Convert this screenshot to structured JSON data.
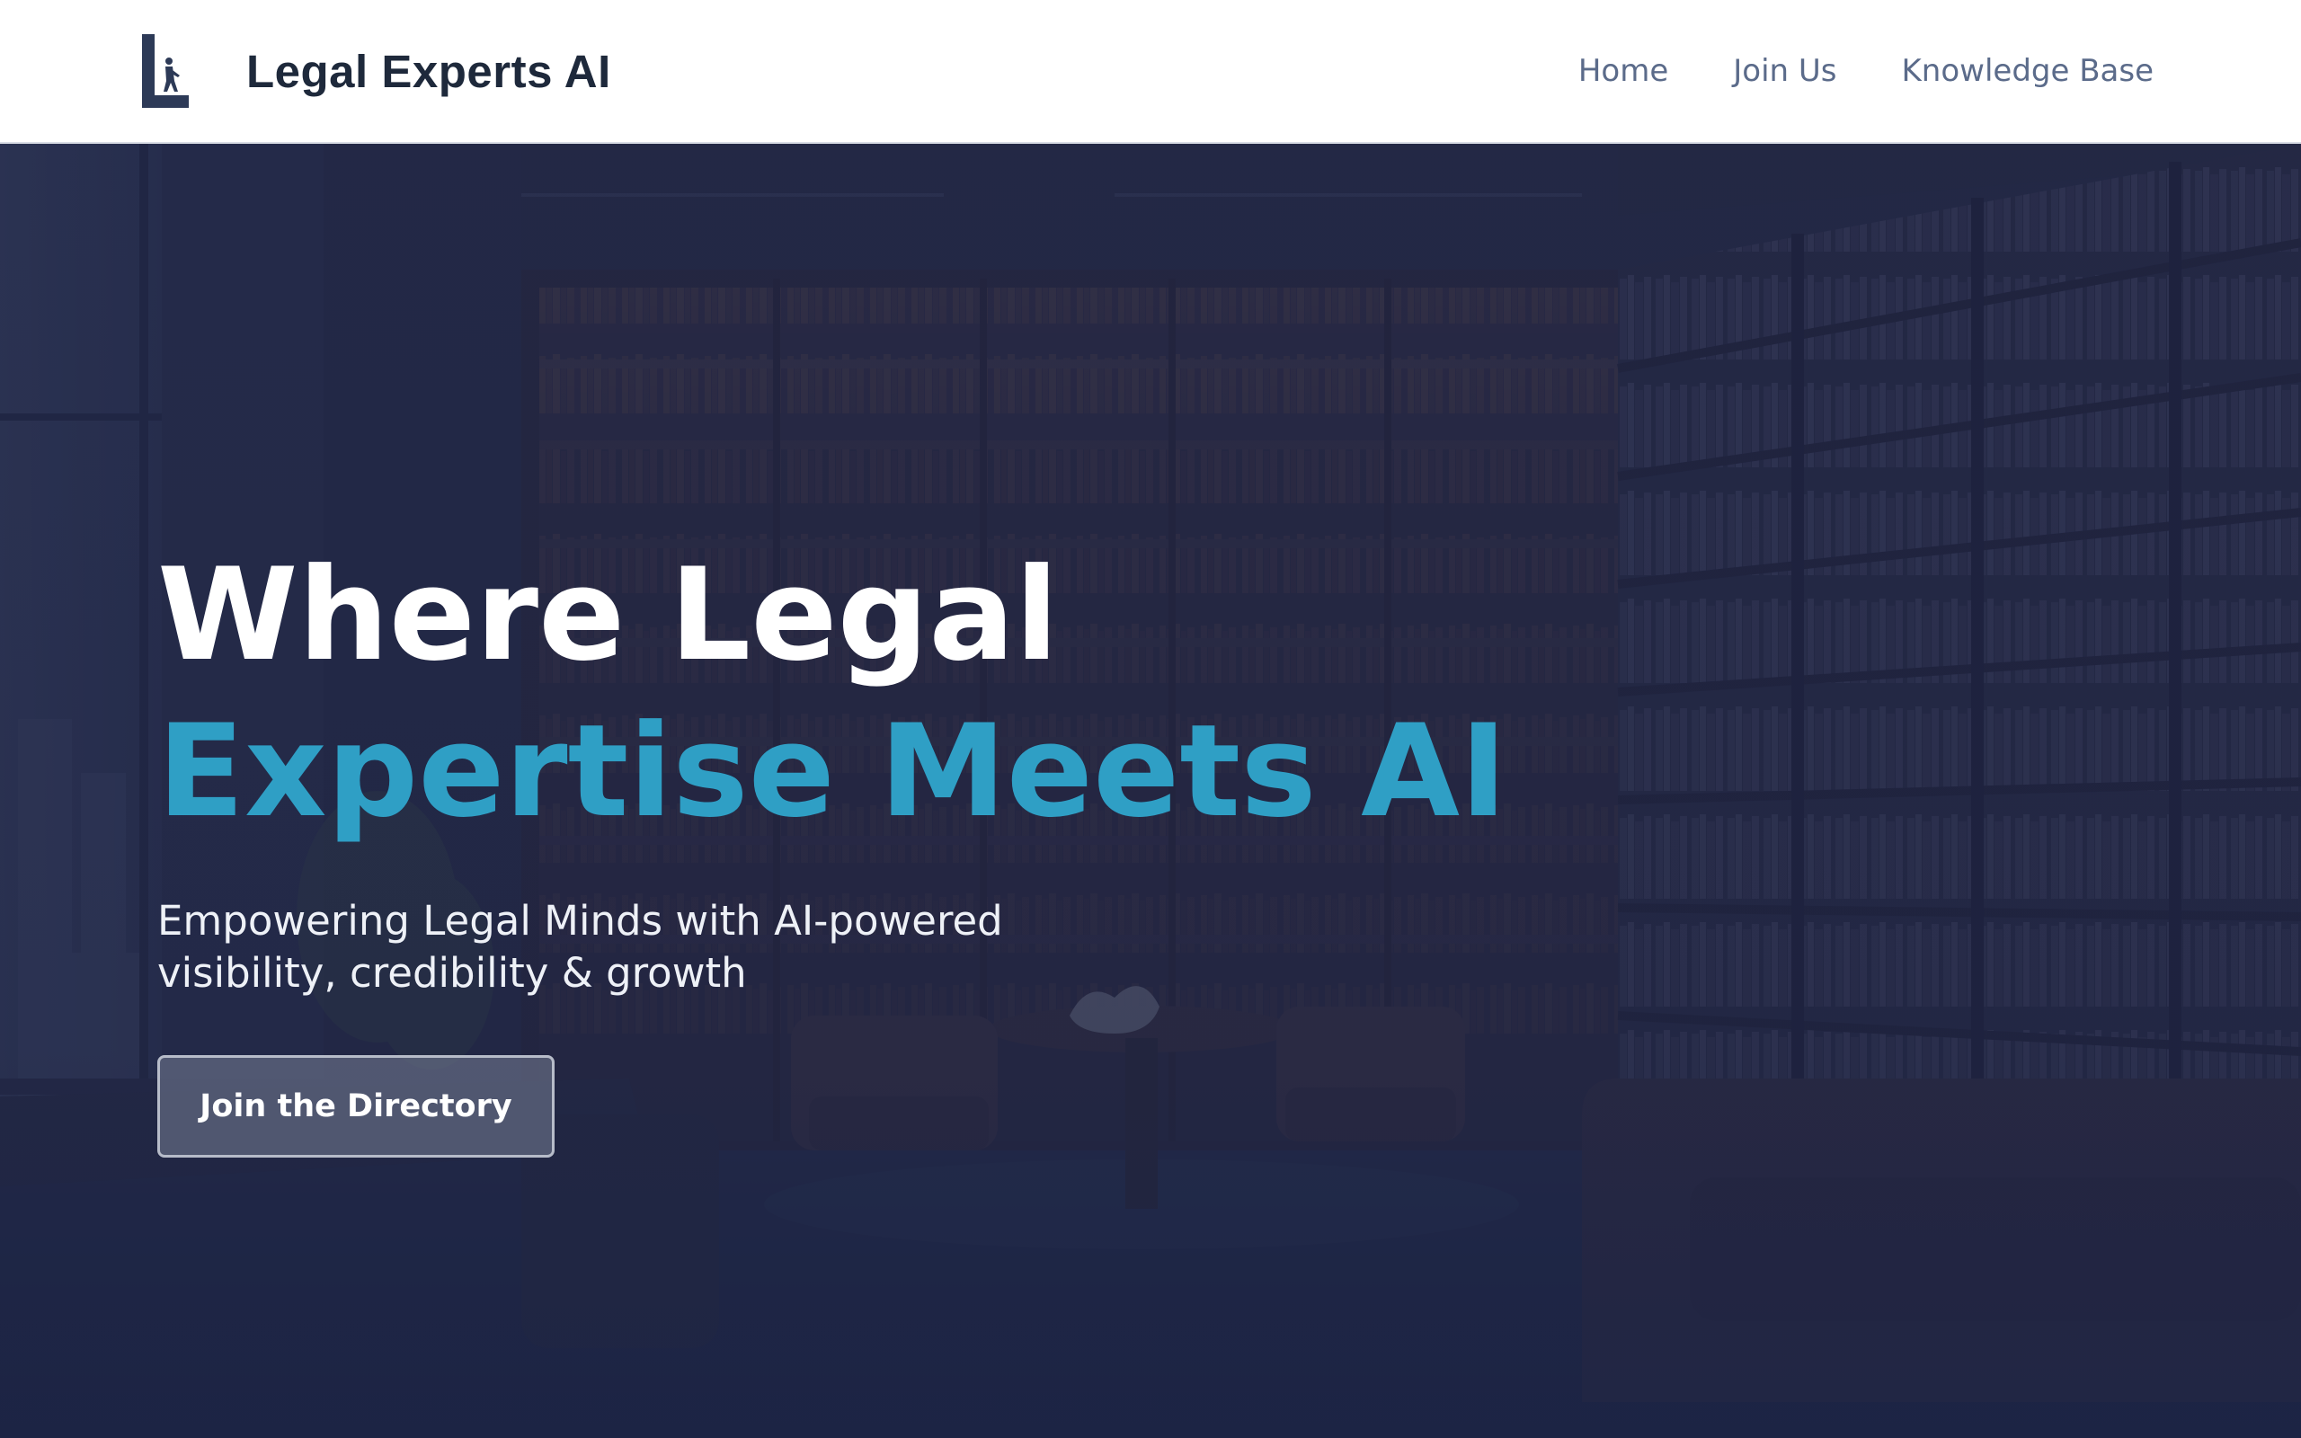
{
  "header": {
    "brand_name": "Legal Experts AI",
    "logo_icon": "scales-figure-logo-icon",
    "nav": [
      {
        "label": "Home"
      },
      {
        "label": "Join Us"
      },
      {
        "label": "Knowledge Base"
      }
    ]
  },
  "hero": {
    "headline_line1": "Where Legal",
    "headline_line2": "Expertise Meets AI",
    "subtitle": "Empowering Legal Minds with AI-powered visibility, credibility & growth",
    "cta_label": "Join the Directory",
    "background": "law-library-office-photo"
  },
  "colors": {
    "accent": "#2f9fc5",
    "header_bg": "#ffffff",
    "brand_text": "#1e293b",
    "nav_text": "#5b6b8a",
    "hero_overlay": "#1f2845"
  }
}
